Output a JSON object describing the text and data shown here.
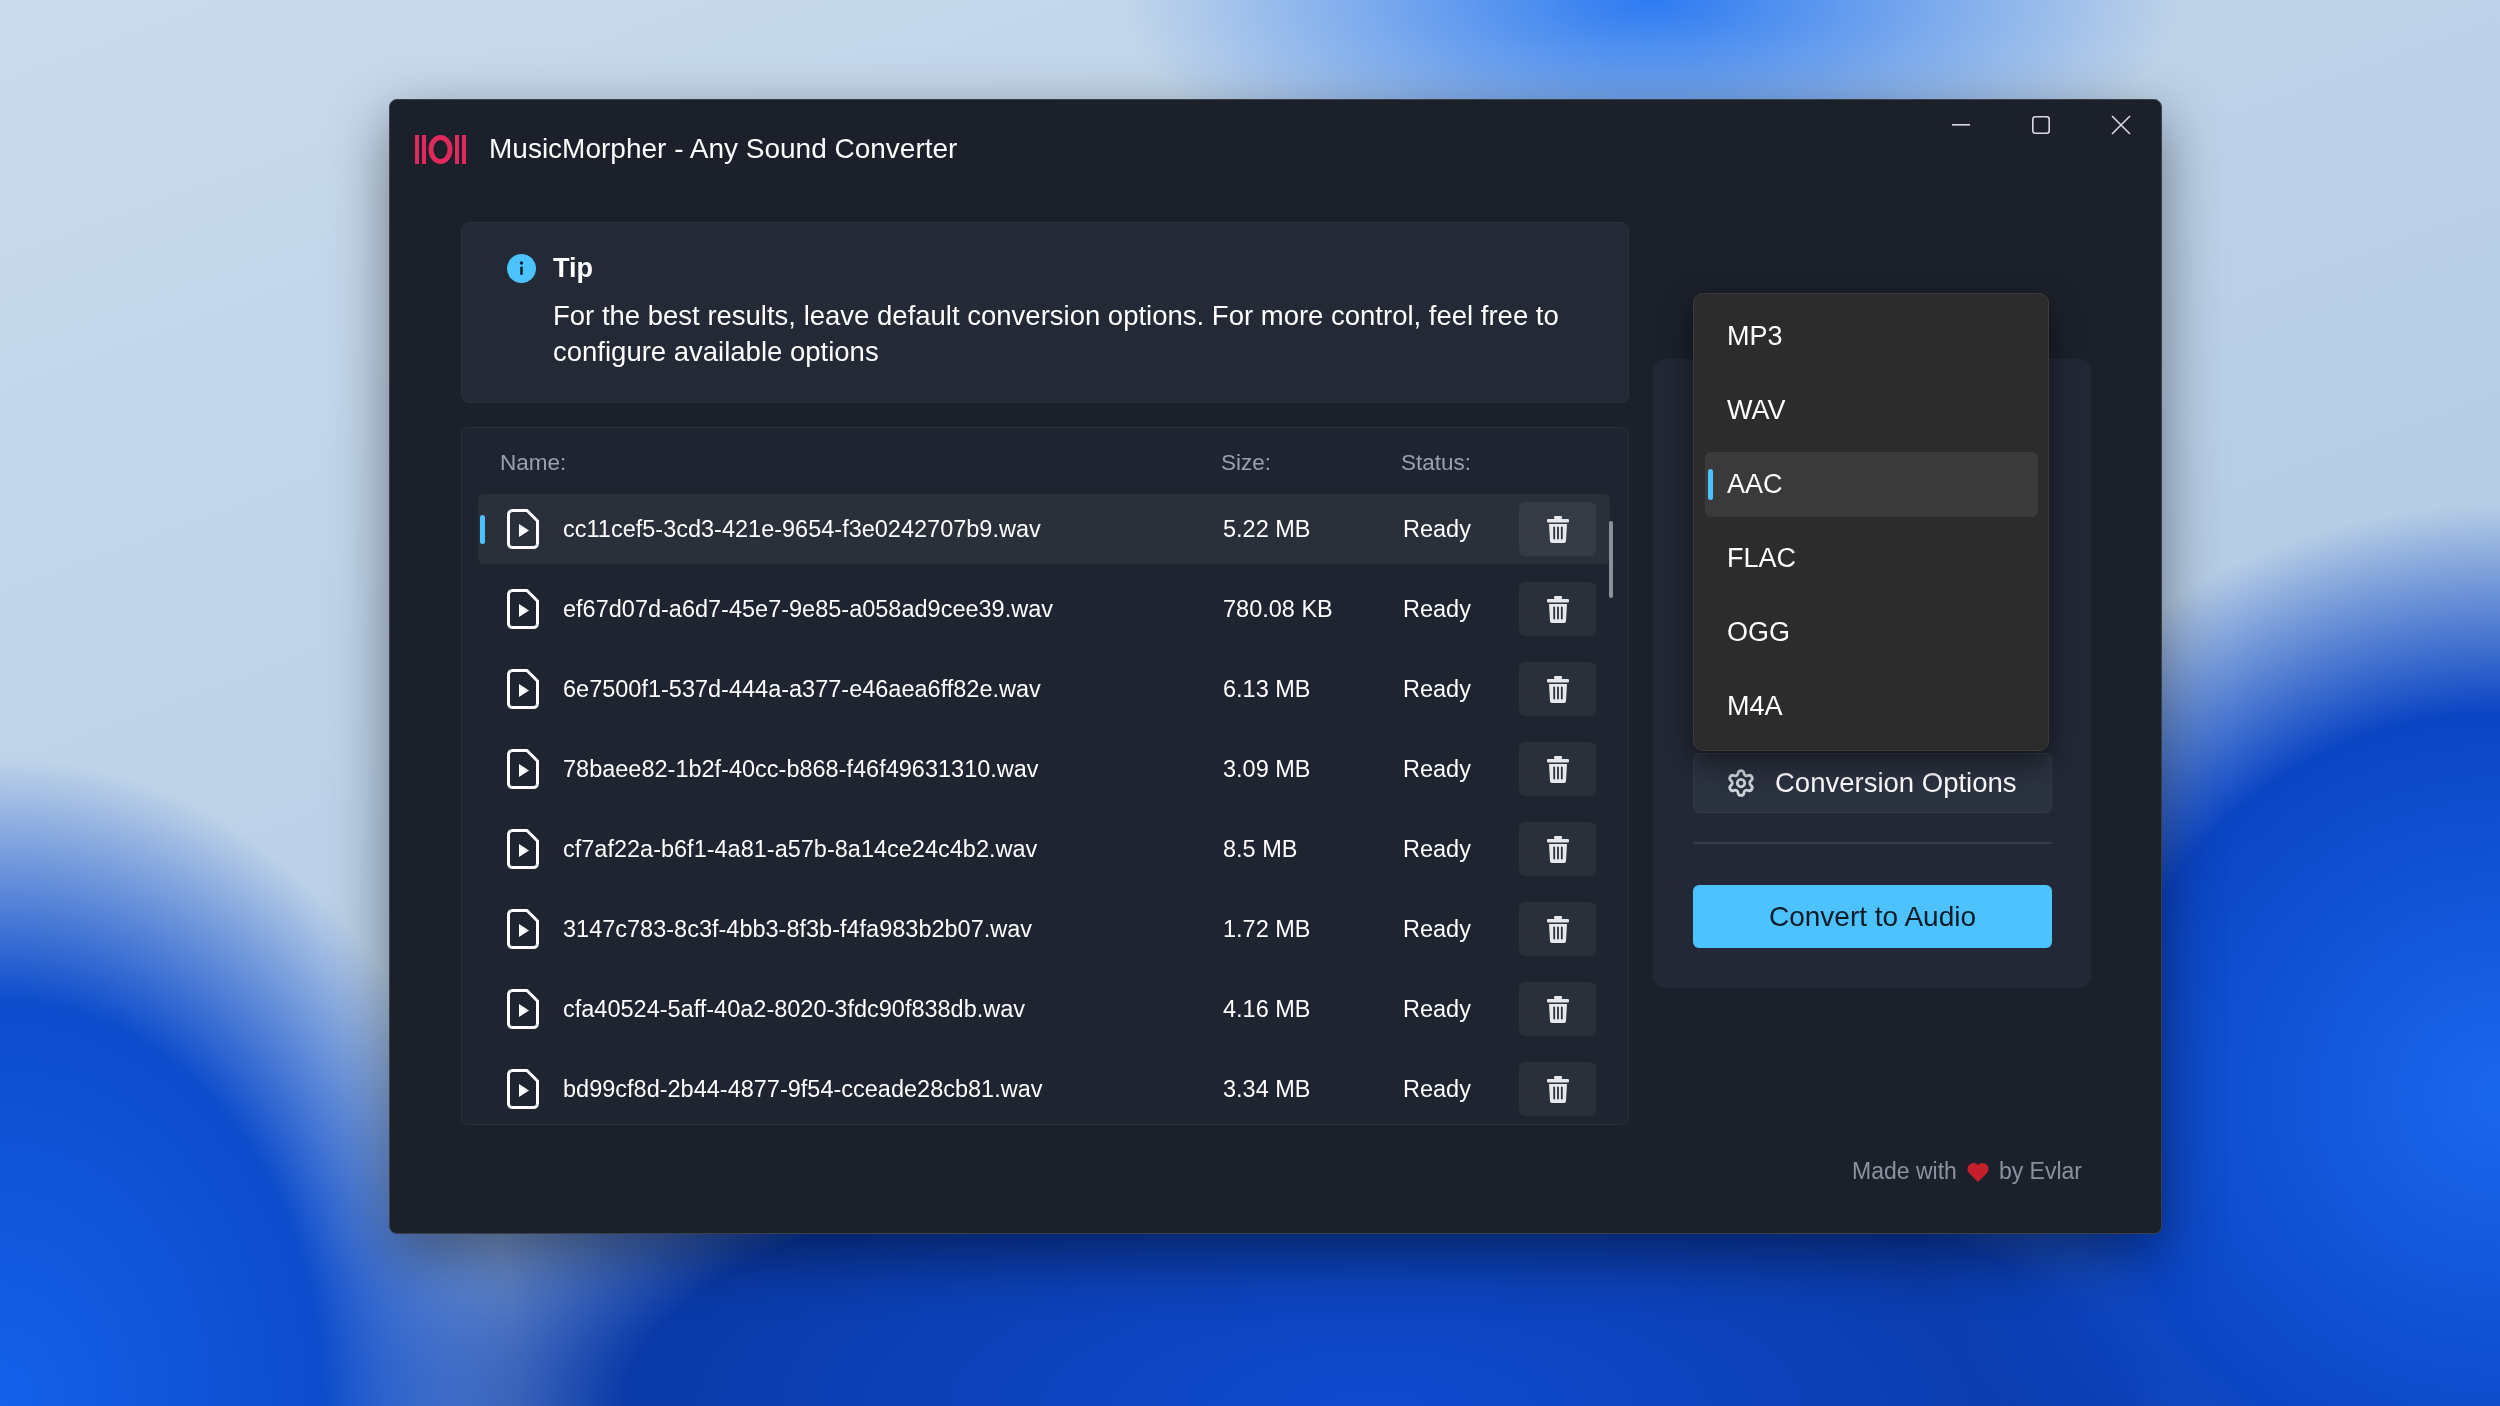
{
  "window": {
    "title": "MusicMorpher - Any Sound Converter"
  },
  "tip": {
    "title": "Tip",
    "message": "For the best results, leave default conversion options. For more control, feel free to configure available options"
  },
  "file_table": {
    "columns": [
      "Name:",
      "Size:",
      "Status:"
    ],
    "rows": [
      {
        "name": "cc11cef5-3cd3-421e-9654-f3e0242707b9.wav",
        "size": "5.22 MB",
        "status": "Ready",
        "selected": true
      },
      {
        "name": "ef67d07d-a6d7-45e7-9e85-a058ad9cee39.wav",
        "size": "780.08 KB",
        "status": "Ready",
        "selected": false
      },
      {
        "name": "6e7500f1-537d-444a-a377-e46aea6ff82e.wav",
        "size": "6.13 MB",
        "status": "Ready",
        "selected": false
      },
      {
        "name": "78baee82-1b2f-40cc-b868-f46f49631310.wav",
        "size": "3.09 MB",
        "status": "Ready",
        "selected": false
      },
      {
        "name": "cf7af22a-b6f1-4a81-a57b-8a14ce24c4b2.wav",
        "size": "8.5 MB",
        "status": "Ready",
        "selected": false
      },
      {
        "name": "3147c783-8c3f-4bb3-8f3b-f4fa983b2b07.wav",
        "size": "1.72 MB",
        "status": "Ready",
        "selected": false
      },
      {
        "name": "cfa40524-5aff-40a2-8020-3fdc90f838db.wav",
        "size": "4.16 MB",
        "status": "Ready",
        "selected": false
      },
      {
        "name": "bd99cf8d-2b44-4877-9f54-cceade28cb81.wav",
        "size": "3.34 MB",
        "status": "Ready",
        "selected": false
      }
    ]
  },
  "format_dropdown": {
    "options": [
      {
        "label": "MP3",
        "selected": false
      },
      {
        "label": "WAV",
        "selected": false
      },
      {
        "label": "AAC",
        "selected": true
      },
      {
        "label": "FLAC",
        "selected": false
      },
      {
        "label": "OGG",
        "selected": false
      },
      {
        "label": "M4A",
        "selected": false
      }
    ]
  },
  "conversion_options_button": {
    "label": "Conversion Options"
  },
  "convert_button": {
    "label": "Convert to Audio"
  },
  "footer": {
    "before_heart": "Made with",
    "after_heart": "by Evlar"
  }
}
